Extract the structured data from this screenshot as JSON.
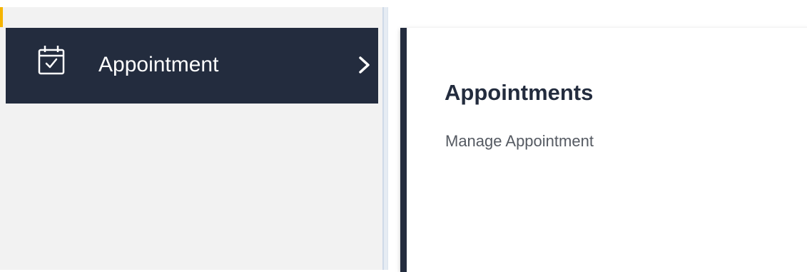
{
  "sidebar": {
    "items": [
      {
        "label": "Appointment",
        "icon": "calendar-check-icon",
        "expand_icon": "chevron-right-icon",
        "active": true
      }
    ]
  },
  "card": {
    "title": "Appointments",
    "subtitle": "Manage Appointment"
  },
  "colors": {
    "sidebar_active_bg": "#232c3e",
    "sidebar_bg": "#f2f2f2",
    "accent": "#f5b400",
    "card_border": "#232c3e",
    "text_primary": "#232c3e",
    "text_secondary": "#555a62"
  }
}
